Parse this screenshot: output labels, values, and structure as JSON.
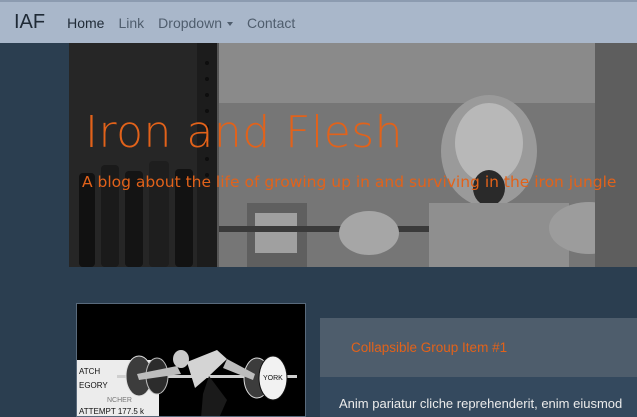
{
  "navbar": {
    "brand": "IAF",
    "links": [
      {
        "label": "Home"
      },
      {
        "label": "Link"
      },
      {
        "label": "Dropdown"
      },
      {
        "label": "Contact"
      }
    ]
  },
  "hero": {
    "title": "Iron and Flesh",
    "subtitle": "A blog about the life of growing up in and surviving in the iron jungle"
  },
  "card": {
    "scoreboard": [
      "ATCH",
      "EGORY",
      "NCHER",
      "ATTEMPT 177.5 k"
    ],
    "plate_text": "YORK"
  },
  "accordion": {
    "item_title": "Collapsible Group Item #1",
    "item_body": "Anim pariatur cliche reprehenderit, enim eiusmod"
  },
  "colors": {
    "accent": "#e2621a",
    "navbar_bg": "#a9b7ca",
    "page_bg": "#2b3e50",
    "panel_head_bg": "#4e5d6c"
  }
}
